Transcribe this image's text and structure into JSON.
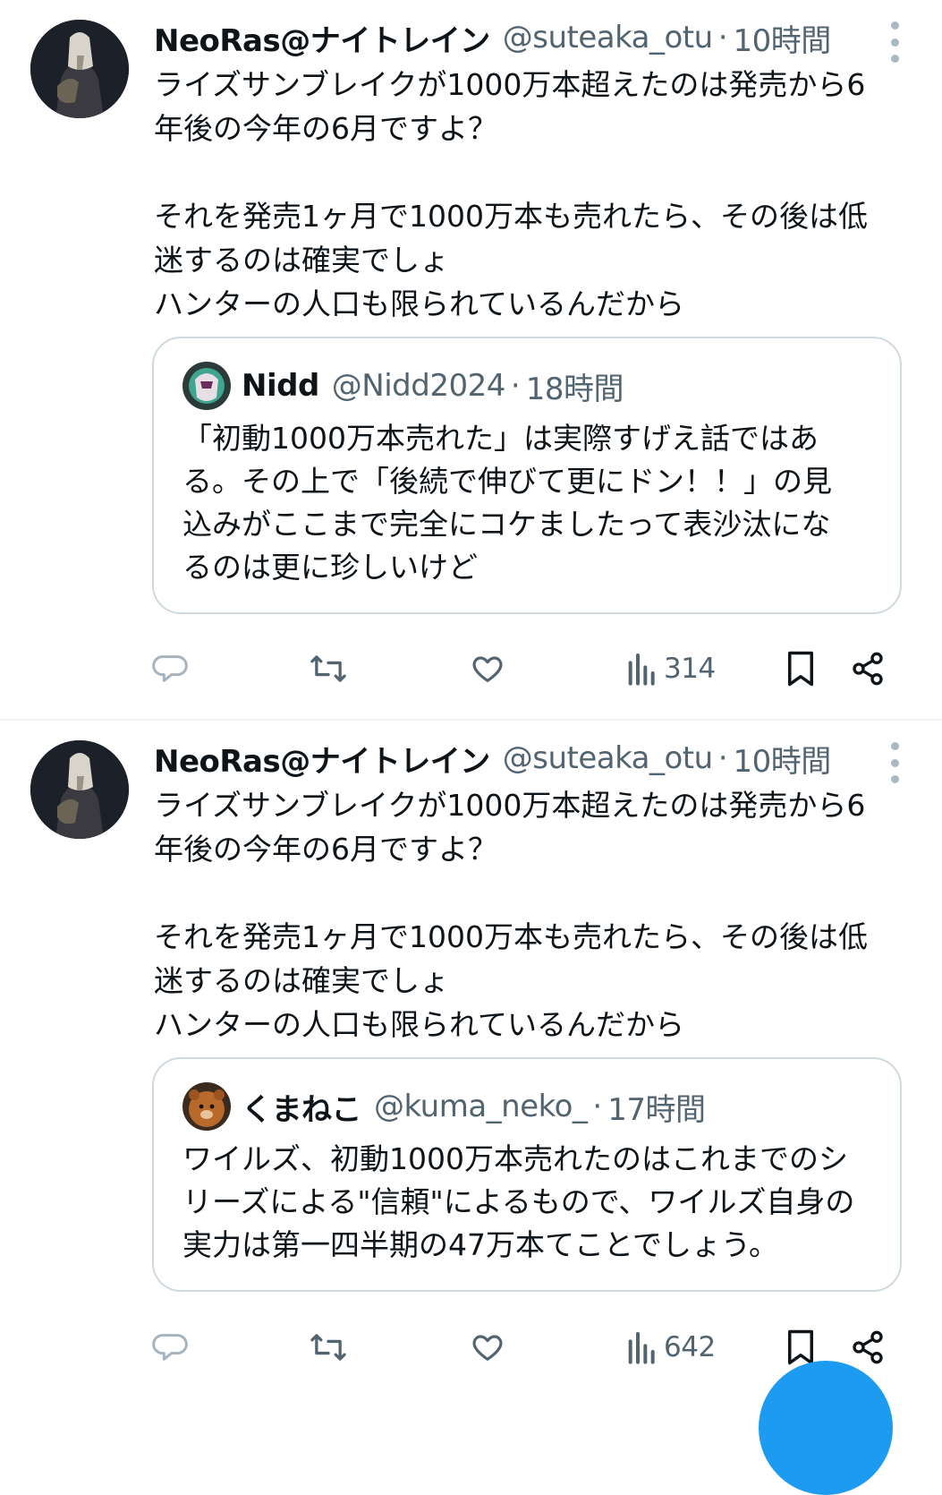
{
  "tweets": [
    {
      "author_name": "NeoRas@ナイトレイン",
      "handle": "@suteaka_otu",
      "separator": "·",
      "time": "10時間",
      "text": "ライズサンブレイクが1000万本超えたのは発売から6\n年後の今年の6月ですよ？\n\nそれを発売1ヶ月で1000万本も売れたら、その後は低\n迷するのは確実でしょ\nハンターの人口も限られているんだから",
      "quote": {
        "author_name": "Nidd",
        "handle": "@Nidd2024",
        "separator": "·",
        "time": "18時間",
        "text": "「初動1000万本売れた」は実際すげえ話ではあ\nる。その上で「後続で伸びて更にドン！！」の見\n込みがここまで完全にコケましたって表沙汰にな\nるのは更に珍しいけど"
      },
      "views": "314"
    },
    {
      "author_name": "NeoRas@ナイトレイン",
      "handle": "@suteaka_otu",
      "separator": "·",
      "time": "10時間",
      "text": "ライズサンブレイクが1000万本超えたのは発売から6\n年後の今年の6月ですよ？\n\nそれを発売1ヶ月で1000万本も売れたら、その後は低\n迷するのは確実でしょ\nハンターの人口も限られているんだから",
      "quote": {
        "author_name": "くまねこ",
        "handle": "@kuma_neko_",
        "separator": "·",
        "time": "17時間",
        "text": "ワイルズ、初動1000万本売れたのはこれまでのシ\nリーズによる\"信頼\"によるもので、ワイルズ自身の\n実力は第一四半期の47万本てことでしょう。"
      },
      "views": "642"
    }
  ],
  "icons": [
    "reply-icon",
    "retweet-icon",
    "like-icon",
    "views-icon",
    "bookmark-icon",
    "share-icon",
    "more-icon"
  ],
  "colors": {
    "text": "#0f1419",
    "secondary": "#536471",
    "border": "#cfd9de",
    "accent": "#1d9bf0"
  }
}
